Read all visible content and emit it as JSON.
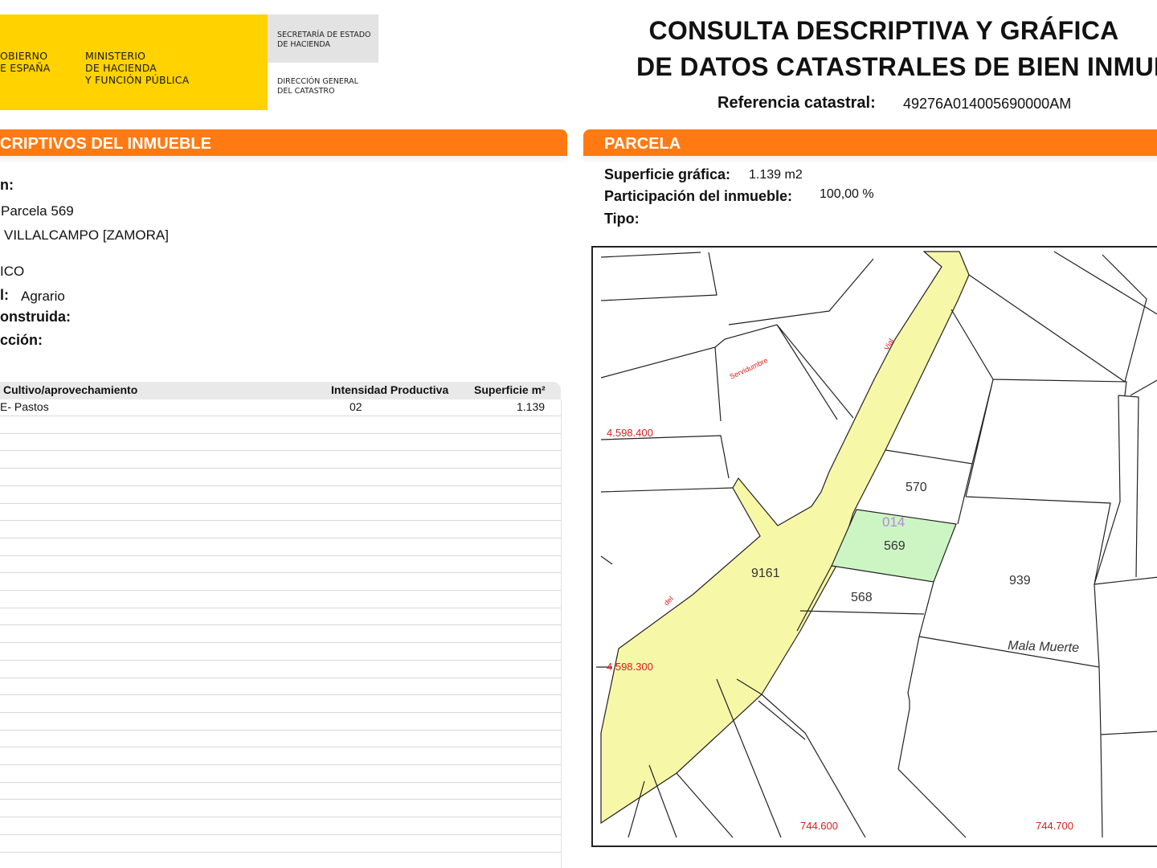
{
  "header": {
    "logo_left": "OBIERNO\nE ESPAÑA",
    "logo_ministry": "MINISTERIO\nDE HACIENDA\nY FUNCIÓN PÚBLICA",
    "logo_secretaria": "SECRETARÍA DE ESTADO\nDE HACIENDA",
    "logo_direccion": "DIRECCIÓN GENERAL\nDEL CATASTRO",
    "title_line1": "CONSULTA DESCRIPTIVA Y GRÁFICA",
    "title_line2": "DE DATOS CATASTRALES DE BIEN INMUEBL",
    "ref_label": "Referencia catastral:",
    "ref_value": "49276A014005690000AM"
  },
  "left": {
    "section_title": "CRIPTIVOS DEL INMUEBLE",
    "loc_label": "n:",
    "loc_line1": "Parcela 569",
    "loc_line2": "VILLALCAMPO [ZAMORA]",
    "clase": "ICO",
    "uso_label": "l:",
    "uso_value": "Agrario",
    "construida_label": "onstruida:",
    "construccion_label": "cción:"
  },
  "table": {
    "headers": [
      "Cultivo/aprovechamiento",
      "Intensidad Productiva",
      "Superficie m²"
    ],
    "rows": [
      {
        "cultivo": "E- Pastos",
        "intensidad": "02",
        "superficie": "1.139"
      }
    ]
  },
  "right": {
    "section_title": "PARCELA",
    "sup_label": "Superficie gráfica:",
    "sup_value": "1.139 m2",
    "part_label": "Participación del inmueble:",
    "part_value": "100,00 %",
    "tipo_label": "Tipo:"
  },
  "map": {
    "parcels": {
      "p570": "570",
      "p014": "014",
      "p569": "569",
      "p9161": "9161",
      "p568": "568",
      "p939": "939"
    },
    "place_name": "Mala Muerte",
    "coords": {
      "y1": "4.598.400",
      "y2": "4.598.300",
      "x1": "744.600",
      "x2": "744.700"
    },
    "small_labels": {
      "vial": "Vial",
      "servidumbre": "Servidumbre",
      "del": "del"
    },
    "colors": {
      "road_fill": "#F7F7A8",
      "selected_parcel": "#CDF5C4",
      "coord_red": "#D42020"
    }
  }
}
